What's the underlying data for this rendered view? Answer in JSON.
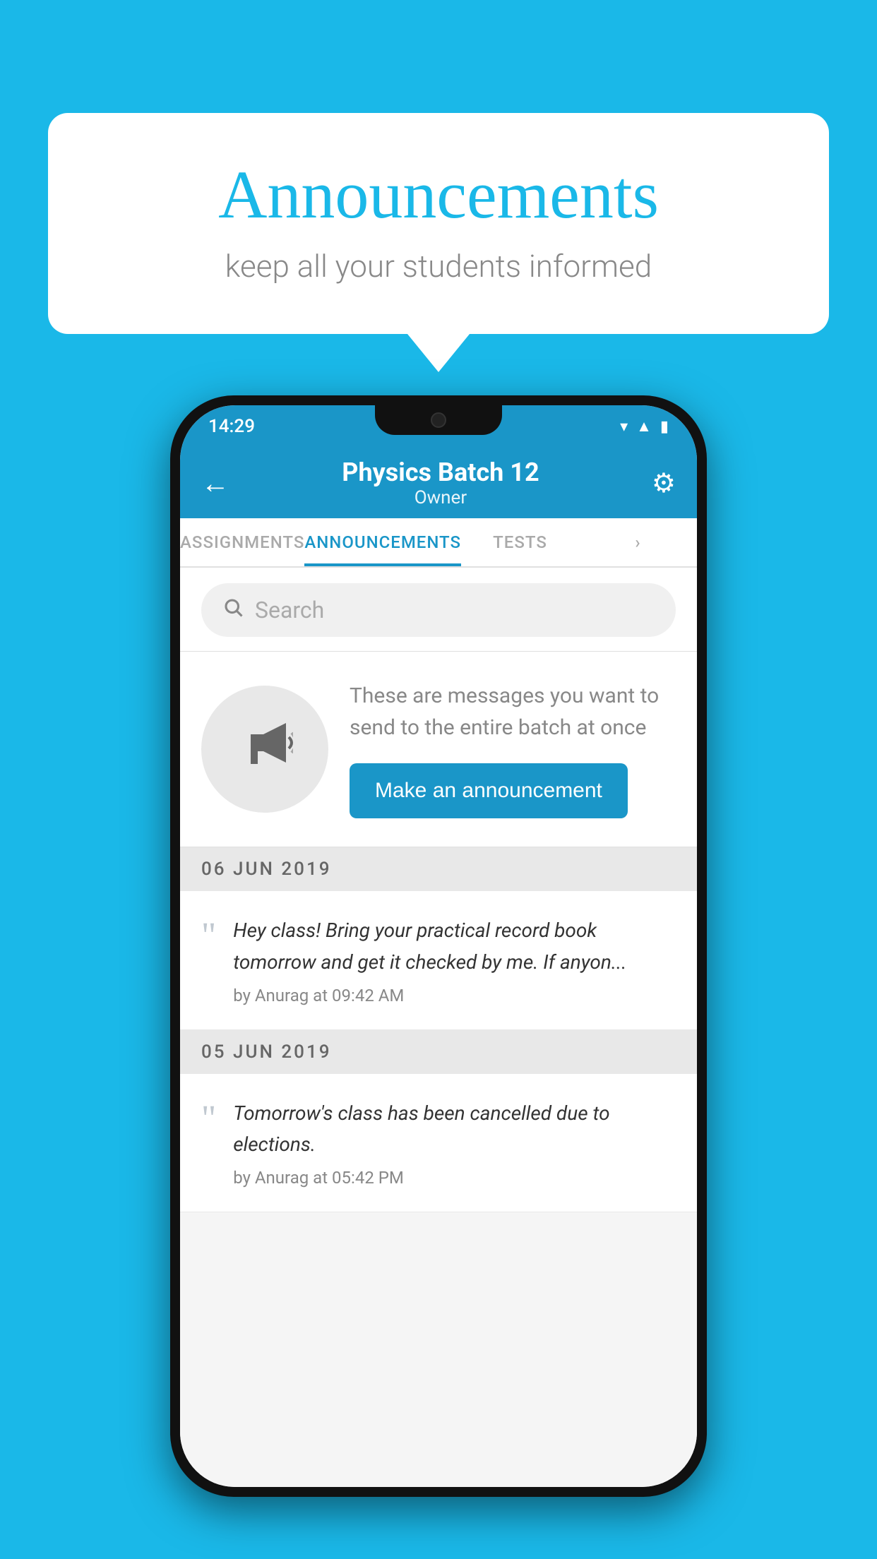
{
  "background_color": "#1ab8e8",
  "speech_bubble": {
    "title": "Announcements",
    "subtitle": "keep all your students informed"
  },
  "status_bar": {
    "time": "14:29",
    "wifi_icon": "▼",
    "signal_icon": "▲",
    "battery_icon": "▮"
  },
  "app_bar": {
    "back_label": "←",
    "title": "Physics Batch 12",
    "subtitle": "Owner",
    "gear_label": "⚙"
  },
  "tabs": [
    {
      "label": "ASSIGNMENTS",
      "active": false
    },
    {
      "label": "ANNOUNCEMENTS",
      "active": true
    },
    {
      "label": "TESTS",
      "active": false
    },
    {
      "label": "...",
      "active": false
    }
  ],
  "search": {
    "placeholder": "Search"
  },
  "promo": {
    "text": "These are messages you want to send to the entire batch at once",
    "button_label": "Make an announcement"
  },
  "announcements": [
    {
      "date": "06  JUN  2019",
      "text": "Hey class! Bring your practical record book tomorrow and get it checked by me. If anyon...",
      "meta": "by Anurag at 09:42 AM"
    },
    {
      "date": "05  JUN  2019",
      "text": "Tomorrow's class has been cancelled due to elections.",
      "meta": "by Anurag at 05:42 PM"
    }
  ]
}
